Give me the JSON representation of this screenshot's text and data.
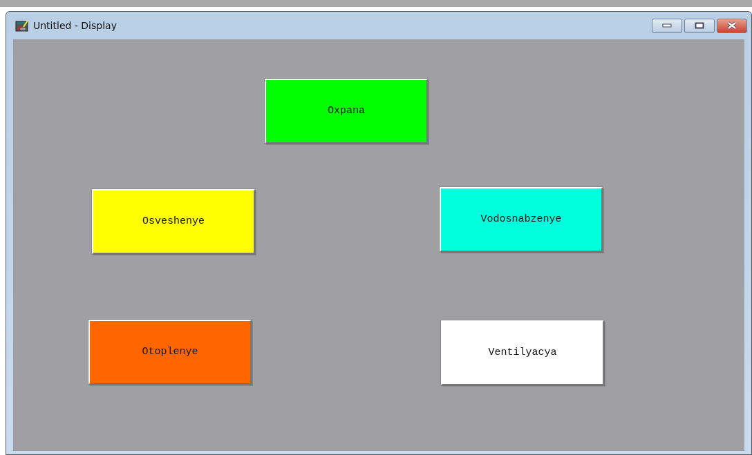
{
  "window": {
    "title": "Untitled - Display"
  },
  "buttons": [
    {
      "label": "Oxpana",
      "color": "#00ff00"
    },
    {
      "label": "Osveshenye",
      "color": "#ffff00"
    },
    {
      "label": "Vodosnabzenye",
      "color": "#00ffdd"
    },
    {
      "label": "Otoplenye",
      "color": "#ff6600"
    },
    {
      "label": "Ventilyacya",
      "color": "#ffffff"
    }
  ]
}
